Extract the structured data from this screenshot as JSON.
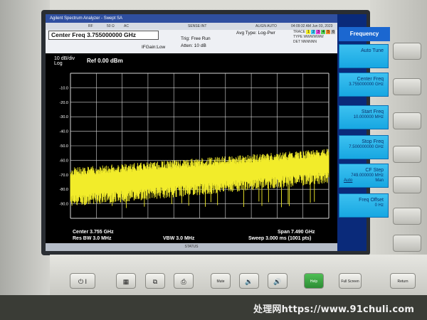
{
  "window": {
    "title": "Agilent Spectrum Analyzer - Swept SA",
    "status_items": [
      "RF",
      "50 Ω",
      "AC",
      "SENSE:INT",
      "ALIGN AUTO"
    ],
    "timestamp": "04:09:32 AM Jun 03, 2023"
  },
  "measurement": {
    "center_freq_label": "Center Freq 3.755000000 GHz",
    "if_gain": "IFGain:Low",
    "trigger": "Trig: Free Run",
    "attenuation": "Atten: 10 dB",
    "avg_type": "Avg Type: Log-Pwr",
    "trace_label": "TRACE",
    "trace_numbers": [
      "1",
      "2",
      "3",
      "4",
      "5",
      "6"
    ],
    "type_label": "TYPE",
    "type_value": "WWWWWW",
    "det_label": "DET",
    "det_value": "NNNNNN"
  },
  "plot": {
    "scale_per_div": "10 dB/div",
    "scale_type": "Log",
    "ref_level": "Ref 0.00 dBm",
    "y_tick_labels": [
      "-10.0",
      "-20.0",
      "-30.0",
      "-40.0",
      "-50.0",
      "-60.0",
      "-70.0",
      "-80.0",
      "-90.0"
    ],
    "trace_color": "#f2ec2a",
    "grid_color": "#d9d9d9"
  },
  "chart_data": {
    "type": "line",
    "ylabel": "dBm",
    "ylim": [
      -100,
      0
    ],
    "xlim": [
      0.01,
      7.5
    ],
    "x_unit": "GHz",
    "grid": true,
    "series": [
      {
        "noise_floor_start_dbm": -68,
        "noise_floor_end_dbm": -55,
        "noise_low_start_dbm": -88,
        "noise_low_end_dbm": -72,
        "min_spike_dbm": -93
      }
    ]
  },
  "footer": {
    "center": "Center 3.755 GHz",
    "res_bw": "Res BW 3.0 MHz",
    "vbw": "VBW 3.0 MHz",
    "span": "Span 7.490 GHz",
    "sweep": "Sweep  3.000 ms (1001 pts)",
    "status": "STATUS"
  },
  "softkeys": {
    "menu_title": "Frequency",
    "items": [
      {
        "label": "Auto Tune",
        "value": ""
      },
      {
        "label": "Center Freq",
        "value": "3.755000000 GHz"
      },
      {
        "label": "Start Freq",
        "value": "10.000000 MHz"
      },
      {
        "label": "Stop Freq",
        "value": "7.500000000 GHz"
      },
      {
        "label": "CF Step",
        "value": "749.000000 MHz",
        "left": "Auto",
        "right": "Man"
      },
      {
        "label": "Freq Offset",
        "value": "0 Hz"
      }
    ]
  },
  "front_panel": {
    "buttons": [
      "⏻ I",
      "",
      "",
      "",
      "Mute",
      "",
      "",
      "Help",
      "Full Screen",
      "Return"
    ]
  },
  "watermark": "处理网https://www.91chuli.com"
}
